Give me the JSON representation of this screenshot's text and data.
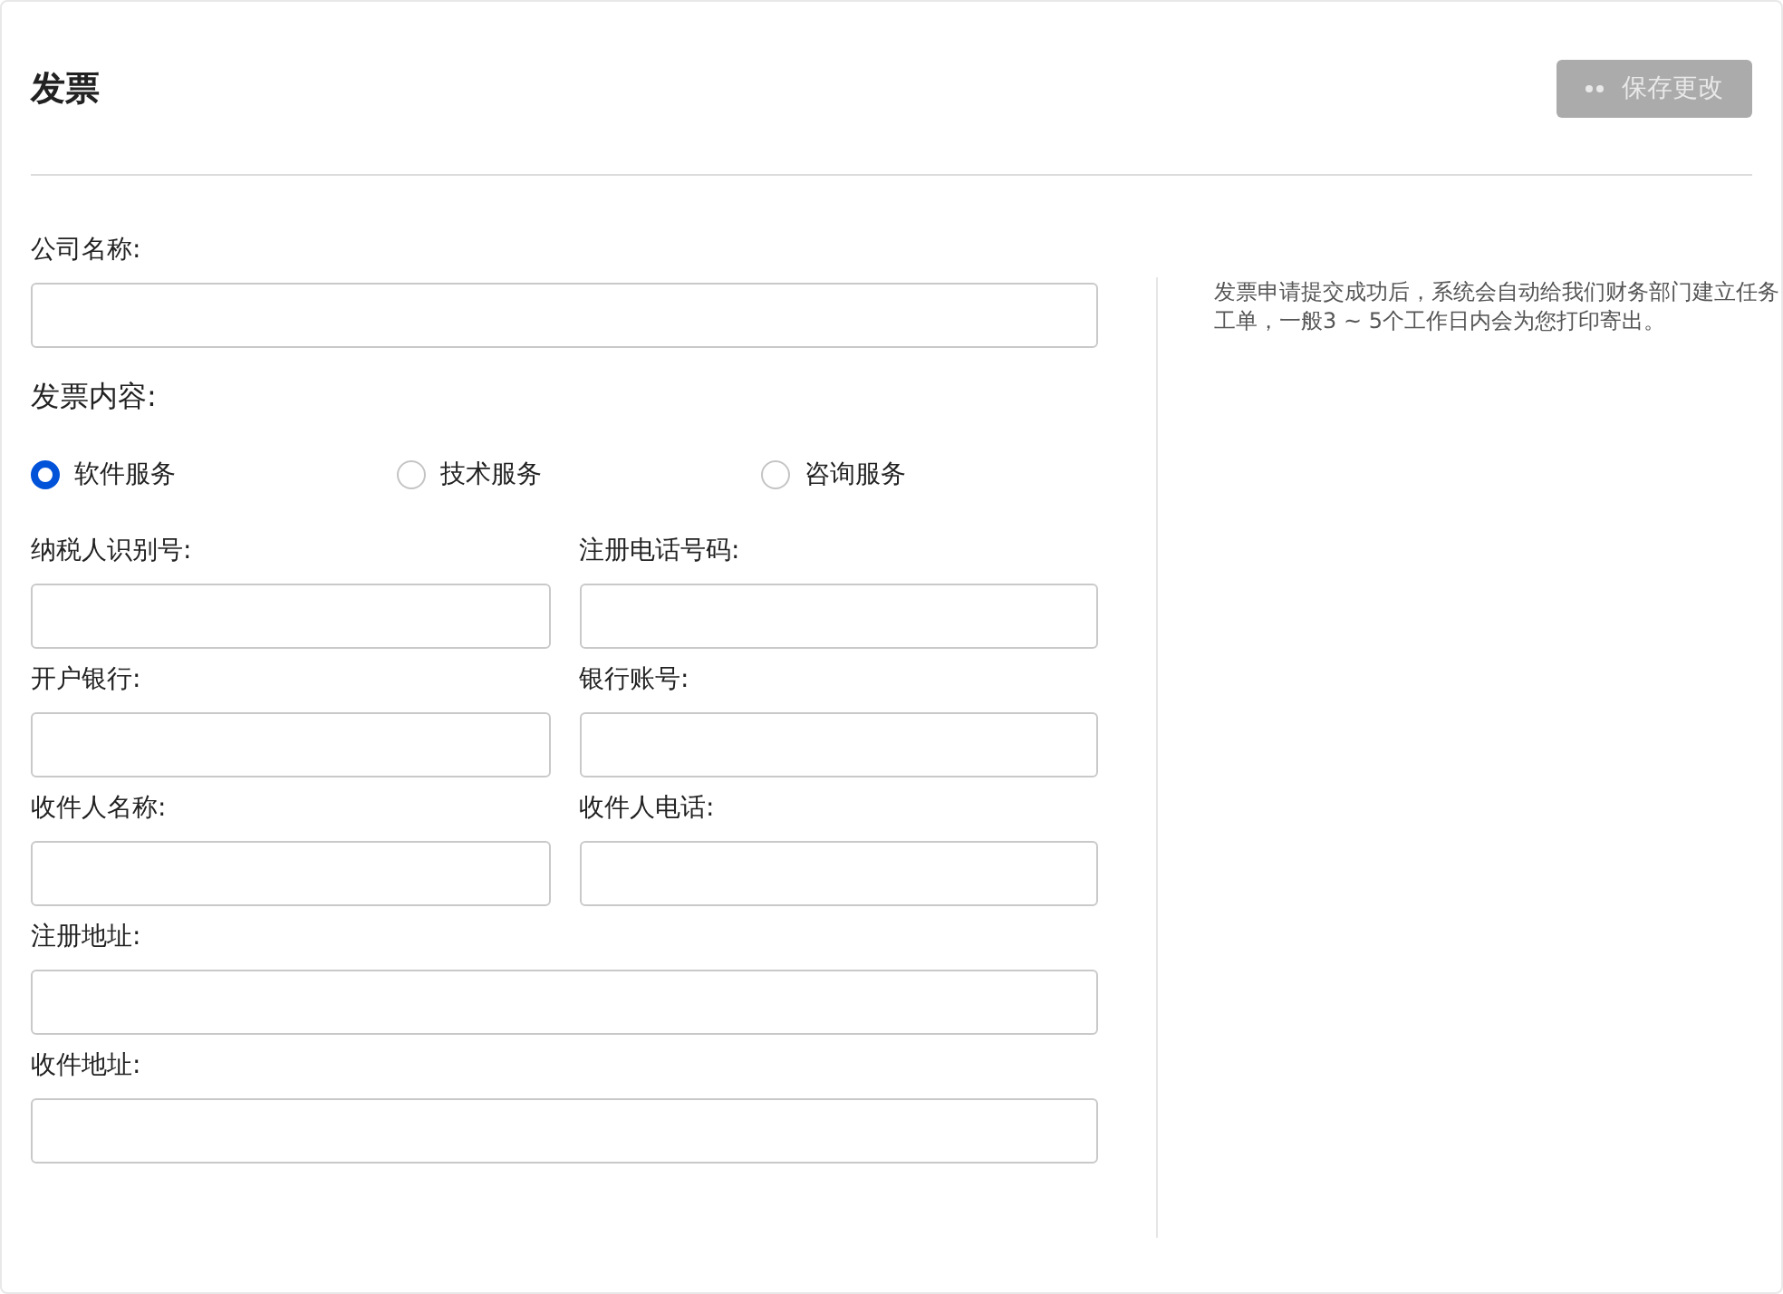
{
  "title": "发票",
  "save_button": {
    "label": "保存更改",
    "disabled": true
  },
  "company_name": {
    "label": "公司名称:"
  },
  "invoice_content": {
    "label": "发票内容:",
    "options": [
      {
        "label": "软件服务",
        "selected": true
      },
      {
        "label": "技术服务",
        "selected": false
      },
      {
        "label": "咨询服务",
        "selected": false
      }
    ]
  },
  "field_rows": [
    [
      {
        "label": "纳税人识别号:"
      },
      {
        "label": "注册电话号码:"
      }
    ],
    [
      {
        "label": "开户银行:"
      },
      {
        "label": "银行账号:"
      }
    ],
    [
      {
        "label": "收件人名称:"
      },
      {
        "label": "收件人电话:"
      }
    ],
    [
      {
        "label": "注册地址:"
      }
    ],
    [
      {
        "label": "收件地址:"
      }
    ]
  ],
  "note": "发票申请提交成功后，系统会自动给我们财务部门建立任务工单，一般3 ~ 5个工作日内会为您打印寄出。"
}
